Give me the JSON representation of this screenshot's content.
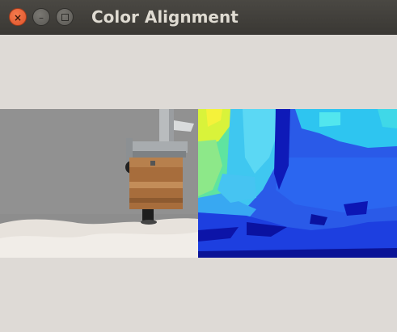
{
  "window": {
    "title": "Color Alignment",
    "close_glyph": "×",
    "minimize_glyph": "–",
    "controls": [
      "close-icon",
      "minimize-icon",
      "maximize-icon"
    ]
  },
  "views": [
    {
      "name": "color-image",
      "kind": "rgb camera image"
    },
    {
      "name": "depth-image",
      "kind": "jet colormap depth image"
    }
  ],
  "colors": {
    "titlebar": "#3e3c37",
    "background": "#dedad6",
    "close_button": "#e8592d"
  }
}
